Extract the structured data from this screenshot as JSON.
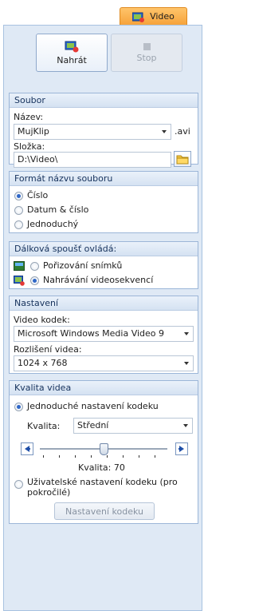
{
  "tab": {
    "label": "Video"
  },
  "toolbar": {
    "record_label": "Nahrát",
    "stop_label": "Stop"
  },
  "file": {
    "header": "Soubor",
    "name_label": "Název:",
    "name_value": "MujKlip",
    "extension": ".avi",
    "folder_label": "Složka:",
    "folder_value": "D:\\Video\\"
  },
  "filename_format": {
    "header": "Formát názvu souboru",
    "options": [
      "Číslo",
      "Datum & číslo",
      "Jednoduchý"
    ],
    "selected_index": 0
  },
  "remote_trigger": {
    "header": "Dálková spoušť ovládá:",
    "options": [
      "Pořizování snímků",
      "Nahrávání videosekvencí"
    ],
    "selected_index": 1
  },
  "settings": {
    "header": "Nastavení",
    "codec_label": "Video kodek:",
    "codec_value": "Microsoft Windows Media Video 9",
    "resolution_label": "Rozlišení videa:",
    "resolution_value": "1024 x 768"
  },
  "quality": {
    "header": "Kvalita videa",
    "simple_option": "Jednoduché nastavení kodeku",
    "quality_label": "Kvalita:",
    "quality_value": "Střední",
    "slider_readout": "Kvalita: 70",
    "slider_level": 0.5,
    "custom_option": "Uživatelské nastavení kodeku (pro pokročilé)",
    "codec_settings_button": "Nastavení kodeku",
    "selected_index": 0
  },
  "colors": {
    "accent_tab": "#f6a33b",
    "panel_bg": "#dfe9f5",
    "header_text": "#16325c",
    "radio_dot": "#2f67c7"
  }
}
